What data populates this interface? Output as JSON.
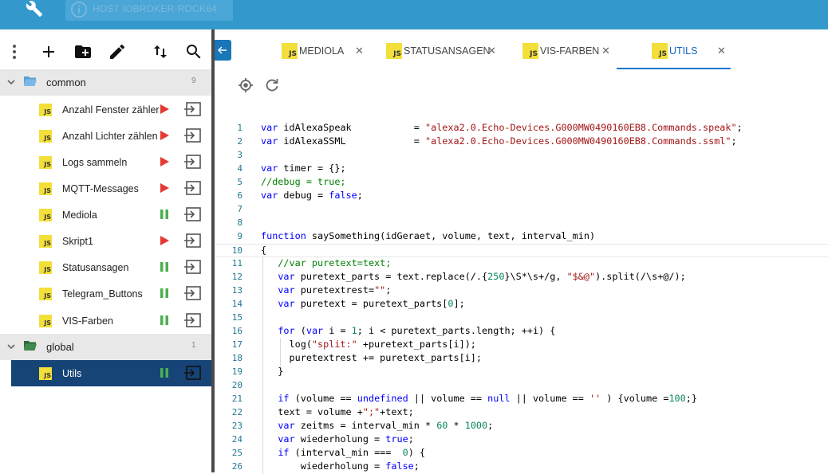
{
  "host": {
    "label": "HOST IOBROKER-ROCK64"
  },
  "colors": {
    "topbar": "#3399cc",
    "accent": "#1976d2",
    "selected_row": "#164477",
    "run": "#e53935",
    "paused": "#4caf50"
  },
  "toolbar": {
    "icons": [
      "more-vert-icon",
      "add-icon",
      "add-folder-icon",
      "edit-icon",
      "sort-icon",
      "search-icon"
    ]
  },
  "tree": {
    "folders": [
      {
        "name": "common",
        "count": "9"
      },
      {
        "name": "global",
        "count": "1"
      }
    ],
    "scripts": [
      {
        "name": "Anzahl Fenster zähler",
        "state": "stopped"
      },
      {
        "name": "Anzahl Lichter zählen",
        "state": "stopped"
      },
      {
        "name": "Logs sammeln",
        "state": "stopped"
      },
      {
        "name": "MQTT-Messages",
        "state": "stopped"
      },
      {
        "name": "Mediola",
        "state": "running"
      },
      {
        "name": "Skript1",
        "state": "stopped"
      },
      {
        "name": "Statusansagen",
        "state": "running"
      },
      {
        "name": "Telegram_Buttons",
        "state": "running"
      },
      {
        "name": "VIS-Farben",
        "state": "running"
      },
      {
        "name": "Utils",
        "state": "running",
        "selected": true
      }
    ],
    "js_badge": "JS"
  },
  "tabs": [
    {
      "label": "MEDIOLA",
      "close": "✕"
    },
    {
      "label": "STATUSANSAGEN",
      "close": "✕"
    },
    {
      "label": "VIS-FARBEN",
      "close": "✕"
    },
    {
      "label": "UTILS",
      "close": "✕",
      "active": true
    }
  ],
  "editor_tools": [
    "locate-icon",
    "refresh-icon"
  ],
  "code": {
    "line_numbers": [
      "1",
      "2",
      "3",
      "4",
      "5",
      "6",
      "7",
      "8",
      "9",
      "10",
      "11",
      "12",
      "13",
      "14",
      "15",
      "16",
      "17",
      "18",
      "19",
      "20",
      "21",
      "22",
      "23",
      "24",
      "25",
      "26"
    ],
    "lines": [
      "var idAlexaSpeak           = \"alexa2.0.Echo-Devices.G000MW0490160EB8.Commands.speak\";",
      "var idAlexaSSML            = \"alexa2.0.Echo-Devices.G000MW0490160EB8.Commands.ssml\";",
      "",
      "var timer = {};",
      "//debug = true;",
      "var debug = false;",
      "",
      "",
      "function saySomething(idGeraet, volume, text, interval_min)",
      "{",
      "   //var puretext=text;",
      "   var puretext_parts = text.replace(/.{250}\\S*\\s+/g, \"$&@\").split(/\\s+@/);",
      "   var puretextrest=\"\";",
      "   var puretext = puretext_parts[0];",
      "",
      "   for (var i = 1; i < puretext_parts.length; ++i) {",
      "     log(\"split:\" +puretext_parts[i]);",
      "     puretextrest += puretext_parts[i];",
      "   }",
      "",
      "   if (volume == undefined || volume == null || volume == '' ) {volume =100;}",
      "   text = volume +\";\"+text;",
      "   var zeitms = interval_min * 60 * 1000;",
      "   var wiederholung = true;",
      "   if (interval_min ===  0) {",
      "       wiederholung = false;"
    ]
  }
}
